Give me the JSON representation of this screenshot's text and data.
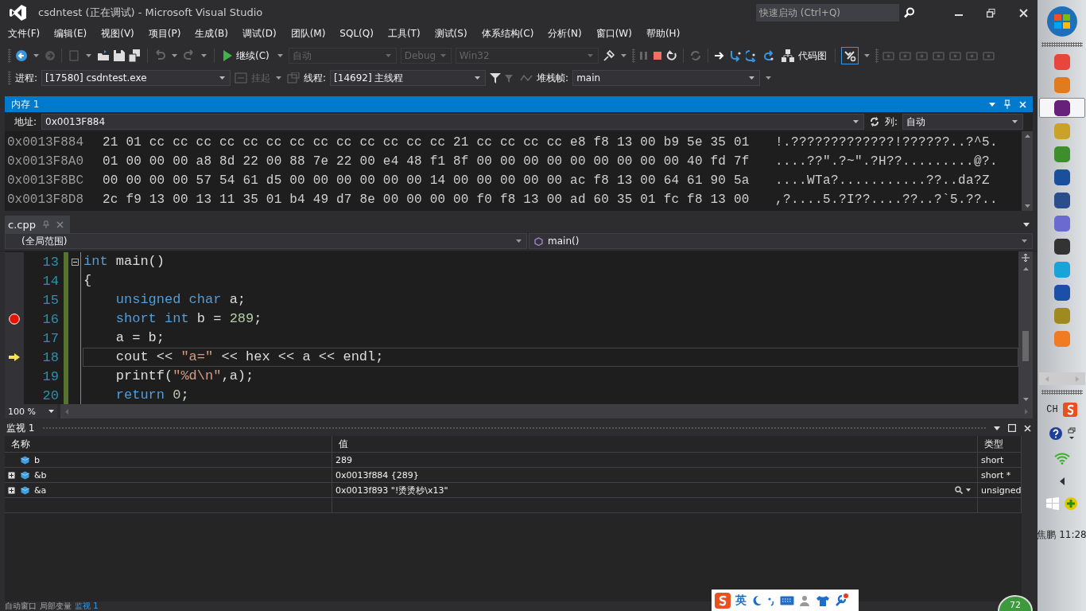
{
  "window": {
    "title": "csdntest (正在调试) - Microsoft Visual Studio",
    "quick_launch": {
      "placeholder": "快速启动 (Ctrl+Q)"
    }
  },
  "menu": [
    "文件(F)",
    "编辑(E)",
    "视图(V)",
    "项目(P)",
    "生成(B)",
    "调试(D)",
    "团队(M)",
    "SQL(Q)",
    "工具(T)",
    "测试(S)",
    "体系结构(C)",
    "分析(N)",
    "窗口(W)",
    "帮助(H)"
  ],
  "toolbar": {
    "continue_label": "继续(C)",
    "configs": [
      {
        "value": "自动",
        "disabled": true
      },
      {
        "value": "Debug",
        "disabled": true
      },
      {
        "value": "Win32",
        "disabled": true
      }
    ],
    "code_map_label": "代码图"
  },
  "debug_location": {
    "process_label": "进程:",
    "process": "[17580] csdntest.exe",
    "suspend_label": "挂起",
    "thread_label": "线程:",
    "thread": "[14692] 主线程",
    "frame_label": "堆栈帧:",
    "frame": "main"
  },
  "memory": {
    "title": "内存 1",
    "address_label": "地址:",
    "address": "0x0013F884",
    "columns_label": "列:",
    "columns": "自动",
    "rows": [
      {
        "address": "0x0013F884",
        "bytes": "21 01 cc cc cc cc cc cc cc cc cc cc cc cc cc 21 cc cc cc cc e8 f8 13 00 b9 5e 35 01",
        "ascii": "!.?????????????!??????..?^5."
      },
      {
        "address": "0x0013F8A0",
        "bytes": "01 00 00 00 a8 8d 22 00 88 7e 22 00 e4 48 f1 8f 00 00 00 00 00 00 00 00 00 40 fd 7f",
        "ascii": "....??\".?~\".?H??.........@?."
      },
      {
        "address": "0x0013F8BC",
        "bytes": "00 00 00 00 57 54 61 d5 00 00 00 00 00 00 14 00 00 00 00 00 ac f8 13 00 64 61 90 5a",
        "ascii": "....WTa?...........??..da?Z"
      },
      {
        "address": "0x0013F8D8",
        "bytes": "2c f9 13 00 13 11 35 01 b4 49 d7 8e 00 00 00 00 f0 f8 13 00 ad 60 35 01 fc f8 13 00",
        "ascii": ",?....5.?I??....??..?`5.??.."
      }
    ]
  },
  "editor": {
    "tab": "c.cpp",
    "scope": "(全局范围)",
    "member": "main()",
    "zoom": "100 %",
    "lines": [
      {
        "number": "13",
        "breakpoint": false,
        "current": false,
        "collapsible": true,
        "tokens": [
          {
            "text": "int",
            "kind": "keyword"
          },
          {
            "text": " main()",
            "kind": "plain"
          }
        ]
      },
      {
        "number": "14",
        "breakpoint": false,
        "current": false,
        "collapsible": false,
        "tokens": [
          {
            "text": "{",
            "kind": "plain"
          }
        ]
      },
      {
        "number": "15",
        "breakpoint": false,
        "current": false,
        "collapsible": false,
        "tokens": [
          {
            "text": "    unsigned char",
            "kind": "keyword"
          },
          {
            "text": " a;",
            "kind": "plain"
          }
        ]
      },
      {
        "number": "16",
        "breakpoint": true,
        "current": false,
        "collapsible": false,
        "tokens": [
          {
            "text": "    short int",
            "kind": "keyword"
          },
          {
            "text": " b = ",
            "kind": "plain"
          },
          {
            "text": "289",
            "kind": "number"
          },
          {
            "text": ";",
            "kind": "plain"
          }
        ]
      },
      {
        "number": "17",
        "breakpoint": false,
        "current": false,
        "collapsible": false,
        "tokens": [
          {
            "text": "    a = b;",
            "kind": "plain"
          }
        ]
      },
      {
        "number": "18",
        "breakpoint": false,
        "current": true,
        "collapsible": false,
        "tokens": [
          {
            "text": "    cout << ",
            "kind": "plain"
          },
          {
            "text": "\"a=\"",
            "kind": "string"
          },
          {
            "text": " << hex << a << endl;",
            "kind": "plain"
          }
        ]
      },
      {
        "number": "19",
        "breakpoint": false,
        "current": false,
        "collapsible": false,
        "tokens": [
          {
            "text": "    printf(",
            "kind": "plain"
          },
          {
            "text": "\"%d\\n\"",
            "kind": "string"
          },
          {
            "text": ",a);",
            "kind": "plain"
          }
        ]
      },
      {
        "number": "20",
        "breakpoint": false,
        "current": false,
        "collapsible": false,
        "tokens": [
          {
            "text": "    return ",
            "kind": "keyword"
          },
          {
            "text": "0",
            "kind": "number"
          },
          {
            "text": ";",
            "kind": "plain"
          }
        ]
      }
    ]
  },
  "watch": {
    "title": "监视 1",
    "columns": [
      "名称",
      "值",
      "类型"
    ],
    "rows": [
      {
        "name": "b",
        "value": "289",
        "type": "short",
        "expandable": false,
        "visualizer": false
      },
      {
        "name": "&b",
        "value": "0x0013f884 {289}",
        "type": "short *",
        "expandable": true,
        "visualizer": false
      },
      {
        "name": "&a",
        "value": "0x0013f893 \"!烫烫杪\\x13\"",
        "type": "unsigned",
        "expandable": true,
        "visualizer": true
      }
    ]
  },
  "bottom_tabs": [
    {
      "label": "自动窗口",
      "selected": false
    },
    {
      "label": "局部变量",
      "selected": false
    },
    {
      "label": "监视 1",
      "selected": true
    }
  ],
  "ime": {
    "mode": "英"
  },
  "badge": "72",
  "taskbar": {
    "apps": [
      {
        "color": "#e8453c",
        "selected": false
      },
      {
        "color": "#e07b20",
        "selected": false
      },
      {
        "color": "#68217a",
        "selected": true
      },
      {
        "color": "#c9a227",
        "selected": false
      },
      {
        "color": "#3e8e2e",
        "selected": false
      },
      {
        "color": "#1a4f9c",
        "selected": false
      },
      {
        "color": "#2a4d8c",
        "selected": false
      },
      {
        "color": "#6a6ad0",
        "selected": false
      },
      {
        "color": "#333333",
        "selected": false
      },
      {
        "color": "#1aa3d9",
        "selected": false
      },
      {
        "color": "#1c4fa8",
        "selected": false
      },
      {
        "color": "#a08a20",
        "selected": false
      },
      {
        "color": "#f07b22",
        "selected": false
      }
    ],
    "language": "CH",
    "user": "焦鹏",
    "time": "11:28"
  }
}
